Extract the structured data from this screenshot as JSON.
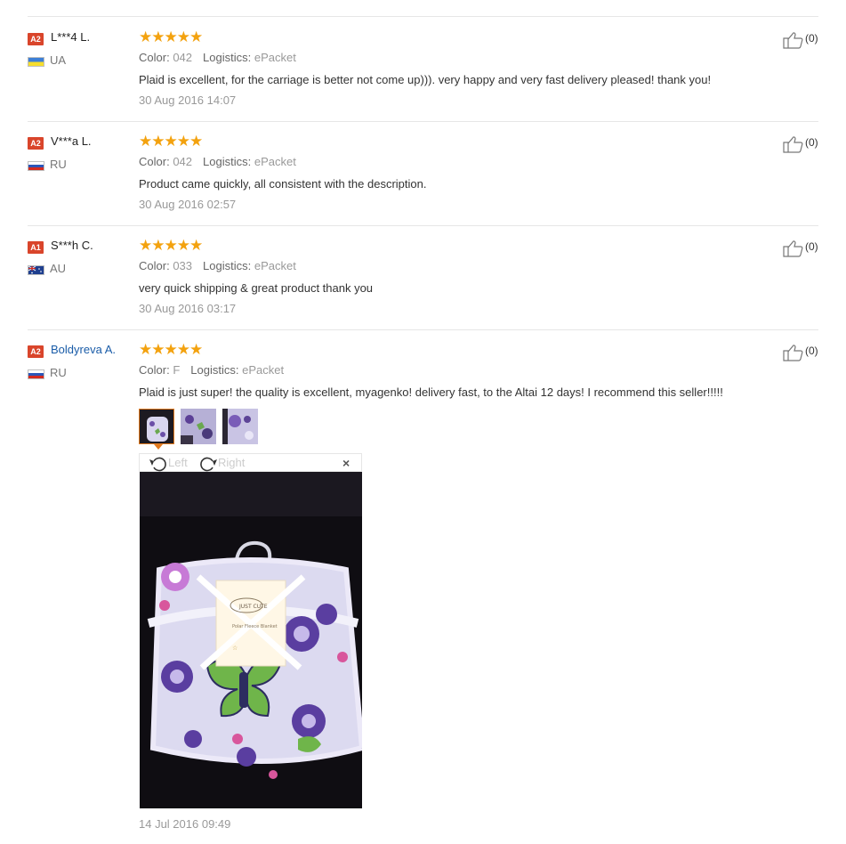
{
  "reviews": [
    {
      "level": "A2",
      "name": "L***4 L.",
      "country": "UA",
      "color_label": "Color:",
      "color": "042",
      "logistics_label": "Logistics:",
      "logistics": "ePacket",
      "text": "Plaid is excellent, for the carriage is better not come up))). very happy and very fast delivery pleased! thank you!",
      "date": "30 Aug 2016 14:07",
      "likes": "(0)"
    },
    {
      "level": "A2",
      "name": "V***a L.",
      "country": "RU",
      "color_label": "Color:",
      "color": "042",
      "logistics_label": "Logistics:",
      "logistics": "ePacket",
      "text": "Product came quickly, all consistent with the description.",
      "date": "30 Aug 2016 02:57",
      "likes": "(0)"
    },
    {
      "level": "A1",
      "name": "S***h C.",
      "country": "AU",
      "color_label": "Color:",
      "color": "033",
      "logistics_label": "Logistics:",
      "logistics": "ePacket",
      "text": "very quick shipping & great product thank you",
      "date": "30 Aug 2016 03:17",
      "likes": "(0)"
    },
    {
      "level": "A2",
      "name": "Boldyreva A.",
      "country": "RU",
      "color_label": "Color:",
      "color": "F",
      "logistics_label": "Logistics:",
      "logistics": "ePacket",
      "text": "Plaid is just super! the quality is excellent, myagenko! delivery fast, to the Altai 12 days! I recommend this seller!!!!!",
      "date": "14 Jul 2016 09:49",
      "likes": "(0)"
    }
  ],
  "stars": "★★★★★",
  "viewer": {
    "left_label": "Left",
    "right_label": "Right",
    "close_label": "×"
  },
  "package_label": {
    "brand": "JUST CUTE",
    "line1": "Polar Fleece Blanket"
  },
  "colors": {
    "badge": "#d9452b",
    "star": "#f3a20f",
    "link": "#1a5ca8",
    "thumb_selected": "#e27a1f"
  },
  "icons": [
    "thumbs-up-icon",
    "rotate-left-icon",
    "rotate-right-icon",
    "close-icon",
    "flag-icon"
  ]
}
